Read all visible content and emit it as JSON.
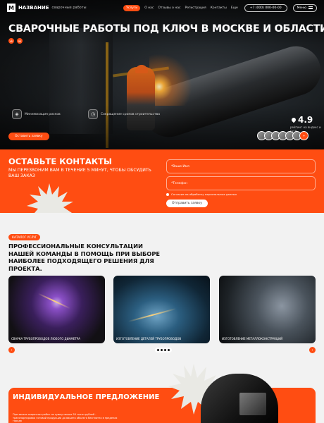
{
  "nav": {
    "logo_letter": "М",
    "logo_name": "НАЗВАНИЕ",
    "logo_sub": "сварочные работы",
    "services_button": "Услуги",
    "links": [
      "О нас",
      "Отзывы о нас",
      "Регистрация",
      "Контакты",
      "Еще"
    ],
    "phone": "+7 (000) 000-00-00",
    "menu_label": "Меню"
  },
  "hero": {
    "title": "СВАРОЧНЫЕ РАБОТЫ ПОД КЛЮЧ В МОСКВЕ И ОБЛАСТИ",
    "social_icons": [
      "vk-icon",
      "ok-icon"
    ],
    "features": [
      {
        "icon": "shield-icon",
        "text": "Минимизация рисков"
      },
      {
        "icon": "clock-icon",
        "text": "Сокращение сроков строительства"
      }
    ],
    "cta": "Оставить заявку",
    "rating_value": "4.9",
    "rating_sub": "рейтинг на яндекс и гугл",
    "avatars_more": "+"
  },
  "contact": {
    "title": "ОСТАВЬТЕ КОНТАКТЫ",
    "subtitle": "МЫ ПЕРЕЗВОНИМ ВАМ В ТЕЧЕНИЕ 5 МИНУТ, ЧТОБЫ ОБСУДИТЬ ВАШ ЗАКАЗ",
    "name_placeholder": "*Ваше Имя",
    "phone_placeholder": "*Телефон",
    "consent": "Согласие на обработку персональных данных",
    "submit": "Отправить заявку"
  },
  "services": {
    "tag": "КАТАЛОГ УСЛУГ",
    "title": "ПРОФЕССИОНАЛЬНЫЕ КОНСУЛЬТАЦИИ НАШЕЙ КОМАНДЫ В ПОМОЩЬ ПРИ ВЫБОРЕ НАИБОЛЕЕ ПОДХОДЯЩЕГО РЕШЕНИЯ ДЛЯ ПРОЕКТА.",
    "cards": [
      {
        "label": "Сварка трубопроводов любого диаметра"
      },
      {
        "label": "Изготовление деталей трубопроводов"
      },
      {
        "label": "Изготовление металлоконструкций"
      }
    ],
    "prev_arrow": "‹",
    "next_arrow": "›"
  },
  "offer": {
    "title": "ИНДИВИДУАЛЬНОЕ ПРЕДЛОЖЕНИЕ",
    "subtitle": "При заказе сварочных работ на сумму свыше 50 тысяч рублей - транспортировка готовой продукции до вашего объекта бесплатно в пределах города"
  },
  "colors": {
    "accent": "#ff4d12",
    "dark": "#111111"
  }
}
